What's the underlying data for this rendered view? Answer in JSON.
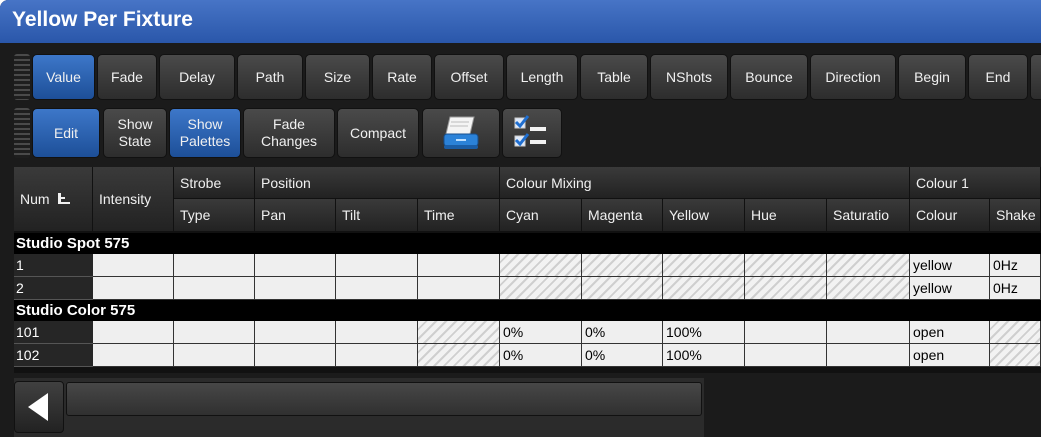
{
  "window": {
    "title": "Yellow Per Fixture"
  },
  "toolbar_attributes": [
    {
      "label": "Value",
      "active": true
    },
    {
      "label": "Fade",
      "active": false
    },
    {
      "label": "Delay",
      "active": false
    },
    {
      "label": "Path",
      "active": false
    },
    {
      "label": "Size",
      "active": false
    },
    {
      "label": "Rate",
      "active": false
    },
    {
      "label": "Offset",
      "active": false
    },
    {
      "label": "Length",
      "active": false
    },
    {
      "label": "Table",
      "active": false
    },
    {
      "label": "NShots",
      "active": false
    },
    {
      "label": "Bounce",
      "active": false
    },
    {
      "label": "Direction",
      "active": false
    },
    {
      "label": "Begin",
      "active": false
    },
    {
      "label": "End",
      "active": false
    }
  ],
  "toolbar_view": {
    "edit": "Edit",
    "show_state_1": "Show",
    "show_state_2": "State",
    "show_palettes_1": "Show",
    "show_palettes_2": "Palettes",
    "fade_changes_1": "Fade",
    "fade_changes_2": "Changes",
    "compact": "Compact"
  },
  "table": {
    "group_headers": {
      "num": "Num",
      "intensity": "Intensity",
      "strobe": "Strobe",
      "position": "Position",
      "colour_mixing": "Colour Mixing",
      "colour_1": "Colour 1"
    },
    "sub_headers": [
      "Type",
      "Pan",
      "Tilt",
      "Time",
      "Cyan",
      "Magenta",
      "Yellow",
      "Hue",
      "Saturatio",
      "Colour",
      "Shake"
    ],
    "groups": [
      {
        "name": "Studio Spot 575",
        "rows": [
          {
            "num": "1",
            "cells": [
              "",
              "",
              "",
              "",
              "",
              "",
              "",
              "",
              "",
              "",
              "yellow",
              "0Hz"
            ],
            "hatch": [
              false,
              false,
              false,
              false,
              false,
              true,
              true,
              true,
              true,
              true,
              false,
              false
            ]
          },
          {
            "num": "2",
            "cells": [
              "",
              "",
              "",
              "",
              "",
              "",
              "",
              "",
              "",
              "",
              "yellow",
              "0Hz"
            ],
            "hatch": [
              false,
              false,
              false,
              false,
              false,
              true,
              true,
              true,
              true,
              true,
              false,
              false
            ]
          }
        ]
      },
      {
        "name": "Studio Color 575",
        "rows": [
          {
            "num": "101",
            "cells": [
              "",
              "",
              "",
              "",
              "",
              "0%",
              "0%",
              "100%",
              "",
              "",
              "open",
              ""
            ],
            "hatch": [
              false,
              false,
              false,
              false,
              true,
              false,
              false,
              false,
              false,
              false,
              false,
              true
            ]
          },
          {
            "num": "102",
            "cells": [
              "",
              "",
              "",
              "",
              "",
              "0%",
              "0%",
              "100%",
              "",
              "",
              "open",
              ""
            ],
            "hatch": [
              false,
              false,
              false,
              false,
              true,
              false,
              false,
              false,
              false,
              false,
              false,
              true
            ]
          }
        ]
      }
    ]
  },
  "colors": {
    "title_bar": "#2f5fb5",
    "active_button": "#2a63b5",
    "panel": "#1b1b1b"
  },
  "icons": [
    "sort-icon",
    "print-icon",
    "checklist-icon",
    "scroll-left-icon"
  ]
}
